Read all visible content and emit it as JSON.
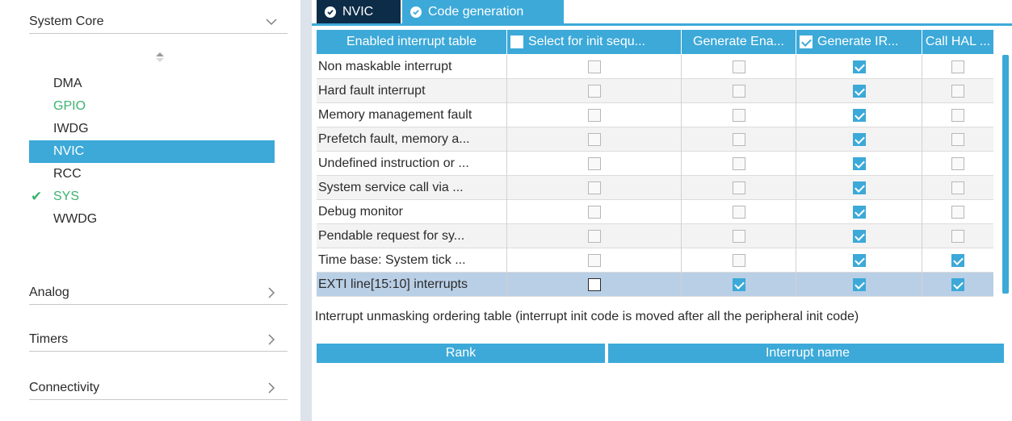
{
  "sidebar": {
    "system_core": {
      "label": "System Core",
      "icon": "chevron-down-icon"
    },
    "items": [
      {
        "label": "DMA",
        "status": "none"
      },
      {
        "label": "GPIO",
        "status": "configured"
      },
      {
        "label": "IWDG",
        "status": "none"
      },
      {
        "label": "NVIC",
        "status": "selected"
      },
      {
        "label": "RCC",
        "status": "none"
      },
      {
        "label": "SYS",
        "status": "checked"
      },
      {
        "label": "WWDG",
        "status": "none"
      }
    ],
    "categories": [
      {
        "label": "Analog",
        "icon": "chevron-right-icon"
      },
      {
        "label": "Timers",
        "icon": "chevron-right-icon"
      },
      {
        "label": "Connectivity",
        "icon": "chevron-right-icon"
      }
    ]
  },
  "tabs": [
    {
      "label": "NVIC",
      "active": false
    },
    {
      "label": "Code generation",
      "active": true
    }
  ],
  "interrupt_table": {
    "columns": [
      {
        "label": "Enabled interrupt table",
        "checkbox": null
      },
      {
        "label": "Select for init sequ...",
        "checkbox": false
      },
      {
        "label": "Generate Ena...",
        "checkbox": null
      },
      {
        "label": "Generate IR...",
        "checkbox": true
      },
      {
        "label": "Call HAL ...",
        "checkbox": null
      }
    ],
    "rows": [
      {
        "name": "Non maskable interrupt",
        "select_init": false,
        "gen_enable": false,
        "gen_irq": true,
        "call_hal": false
      },
      {
        "name": "Hard fault interrupt",
        "select_init": false,
        "gen_enable": false,
        "gen_irq": true,
        "call_hal": false
      },
      {
        "name": "Memory management fault",
        "select_init": false,
        "gen_enable": false,
        "gen_irq": true,
        "call_hal": false
      },
      {
        "name": "Prefetch fault, memory a...",
        "select_init": false,
        "gen_enable": false,
        "gen_irq": true,
        "call_hal": false
      },
      {
        "name": "Undefined instruction or ...",
        "select_init": false,
        "gen_enable": false,
        "gen_irq": true,
        "call_hal": false
      },
      {
        "name": "System service call via ...",
        "select_init": false,
        "gen_enable": false,
        "gen_irq": true,
        "call_hal": false
      },
      {
        "name": "Debug monitor",
        "select_init": false,
        "gen_enable": false,
        "gen_irq": true,
        "call_hal": false
      },
      {
        "name": "Pendable request for sy...",
        "select_init": false,
        "gen_enable": false,
        "gen_irq": true,
        "call_hal": false
      },
      {
        "name": "Time base: System tick ...",
        "select_init": false,
        "gen_enable": false,
        "gen_irq": true,
        "call_hal": true
      },
      {
        "name": "EXTI line[15:10] interrupts",
        "select_init": false,
        "gen_enable": true,
        "gen_irq": true,
        "call_hal": true
      }
    ],
    "highlighted_row": "EXTI line[15:10] interrupts"
  },
  "ordering_note": "Interrupt unmasking ordering table (interrupt init code is moved after all the peripheral init code)",
  "ordering_table": {
    "columns": [
      "Rank",
      "Interrupt name"
    ]
  },
  "colors": {
    "accent": "#3ca9d8",
    "dark_tab": "#0d2c48",
    "configured": "#3cb371",
    "row_highlight": "#b9cfe6"
  }
}
